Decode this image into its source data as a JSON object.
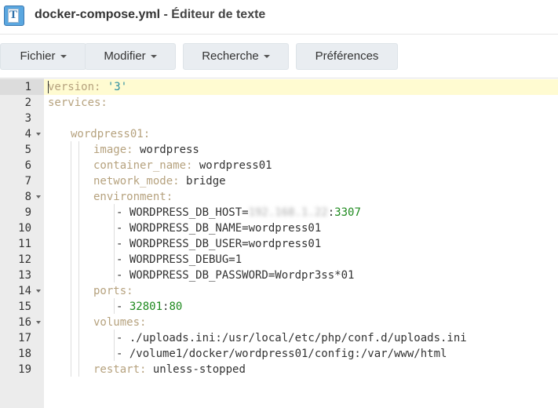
{
  "window": {
    "file_name": "docker-compose.yml",
    "separator": " - ",
    "app_name": "Éditeur de texte"
  },
  "menu": [
    {
      "label": "Fichier",
      "has_dropdown": true
    },
    {
      "label": "Modifier",
      "has_dropdown": true
    },
    {
      "label": "Recherche",
      "has_dropdown": true
    },
    {
      "label": "Préférences",
      "has_dropdown": false
    }
  ],
  "editor": {
    "active_line": 1,
    "lines": [
      {
        "num": "1",
        "text": "version: '3'"
      },
      {
        "num": "2",
        "text": "services:"
      },
      {
        "num": "3",
        "text": ""
      },
      {
        "num": "4",
        "text": "wordpress01:"
      },
      {
        "num": "5",
        "key": "image:",
        "value": " wordpress"
      },
      {
        "num": "6",
        "key": "container_name:",
        "value": " wordpress01"
      },
      {
        "num": "7",
        "key": "network_mode:",
        "value": " bridge"
      },
      {
        "num": "8",
        "text": "environment:"
      },
      {
        "num": "9",
        "prefix": "- WORDPRESS_DB_HOST=",
        "redacted": "192.168.1.22",
        "colon": ":",
        "port": "3307"
      },
      {
        "num": "10",
        "text": "- WORDPRESS_DB_NAME=wordpress01"
      },
      {
        "num": "11",
        "text": "- WORDPRESS_DB_USER=wordpress01"
      },
      {
        "num": "12",
        "text": "- WORDPRESS_DEBUG=1"
      },
      {
        "num": "13",
        "text": "- WORDPRESS_DB_PASSWORD=Wordpr3ss*01"
      },
      {
        "num": "14",
        "text": "ports:"
      },
      {
        "num": "15",
        "dash": "- ",
        "host_port": "32801",
        "colon": ":",
        "container_port": "80"
      },
      {
        "num": "16",
        "text": "volumes:"
      },
      {
        "num": "17",
        "text": "- ./uploads.ini:/usr/local/etc/php/conf.d/uploads.ini"
      },
      {
        "num": "18",
        "text": "- /volume1/docker/wordpress01/config:/var/www/html"
      },
      {
        "num": "19",
        "key": "restart:",
        "value": " unless-stopped"
      }
    ]
  },
  "colors": {
    "yaml_key": "#b6a27e",
    "string": "#2d8fa0",
    "number": "#1f8a1f",
    "active_line_bg": "#fffbd1"
  }
}
